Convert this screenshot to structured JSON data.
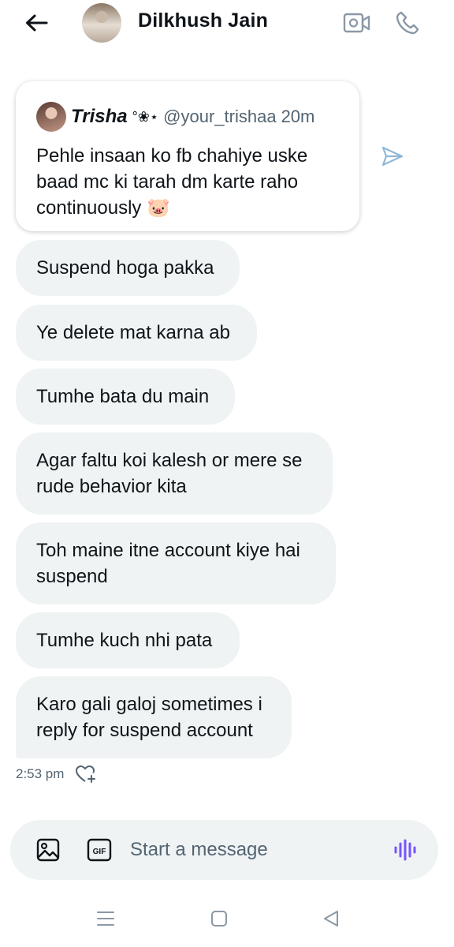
{
  "header": {
    "contact_name": "Dilkhush Jain",
    "icons": [
      "back-arrow-icon",
      "video-call-icon",
      "phone-call-icon"
    ]
  },
  "quoted_tweet": {
    "author_name": "Trisha",
    "author_decor": "°❀⋆",
    "handle": "@your_trishaa",
    "age": "20m",
    "text": "Pehle insaan ko fb chahiye uske baad mc ki tarah dm karte raho continuously 🐷"
  },
  "messages": [
    {
      "text": "Suspend hoga pakka"
    },
    {
      "text": "Ye delete mat karna ab"
    },
    {
      "text": "Tumhe bata du main"
    },
    {
      "text": "Agar faltu koi kalesh or mere se rude behavior kita"
    },
    {
      "text": "Toh maine itne account kiye hai suspend"
    },
    {
      "text": "Tumhe kuch nhi pata"
    },
    {
      "text": "Karo gali galoj sometimes i reply for suspend account"
    }
  ],
  "last_message_time": "2:53 pm",
  "composer": {
    "placeholder": "Start a message",
    "gif_label": "GIF"
  },
  "colors": {
    "bubble_bg": "#eff3f4",
    "text": "#0f1419",
    "muted": "#536471",
    "voice_accent": "#7856ff",
    "share_accent": "#1d9bf0"
  }
}
